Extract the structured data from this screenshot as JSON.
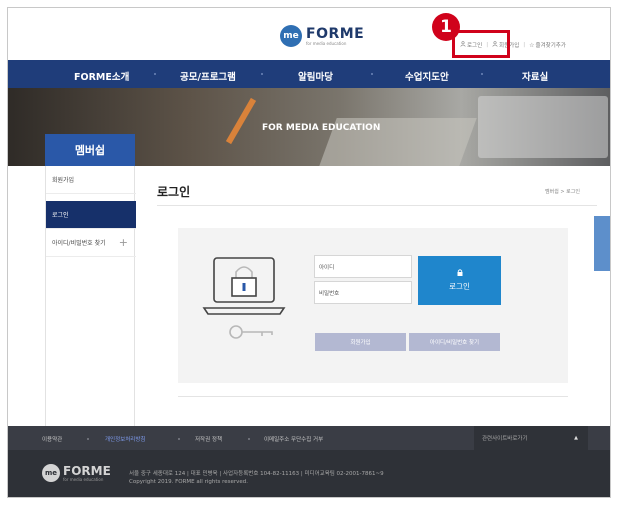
{
  "header": {
    "logo_mark": "me",
    "logo_name": "FORME",
    "logo_tagline": "for media education",
    "util_links": [
      "로그인",
      "회원가입",
      "즐겨찾기추가"
    ],
    "annotation_number": "1"
  },
  "nav": {
    "items": [
      "FORME소개",
      "공모/프로그램",
      "알림마당",
      "수업지도안",
      "자료실"
    ]
  },
  "banner": {
    "title": "FOR MEDIA EDUCATION",
    "section_label": "멤버쉽"
  },
  "sidebar": {
    "items": [
      {
        "label": "회원가입",
        "active": false
      },
      {
        "label": "로그인",
        "active": true
      },
      {
        "label": "아이디/비밀번호 찾기",
        "active": false
      }
    ],
    "expand_symbol": "+"
  },
  "main": {
    "title": "로그인",
    "breadcrumb": "멤버쉽 > 로그인",
    "id_placeholder": "아이디",
    "password_placeholder": "비밀번호",
    "login_button": "로그인",
    "signup_button": "회원가입",
    "find_button": "아이디/비밀번호 찾기"
  },
  "footer": {
    "links": [
      "이용약관",
      "개인정보처리방침",
      "저작권 정책",
      "이메일주소 무단수집 거부"
    ],
    "family_site": "관련사이트바로가기",
    "family_arrow": "▲",
    "logo_mark": "me",
    "logo_name": "FORME",
    "logo_tagline": "for media education",
    "address": "서울 중구 세종대로 124  |  대표 민병욱  |  사업자등록번호 104-82-11163  |  미디어교육팀 02-2001-7861~9",
    "copyright": "Copyright 2019. FORME all rights reserved."
  }
}
